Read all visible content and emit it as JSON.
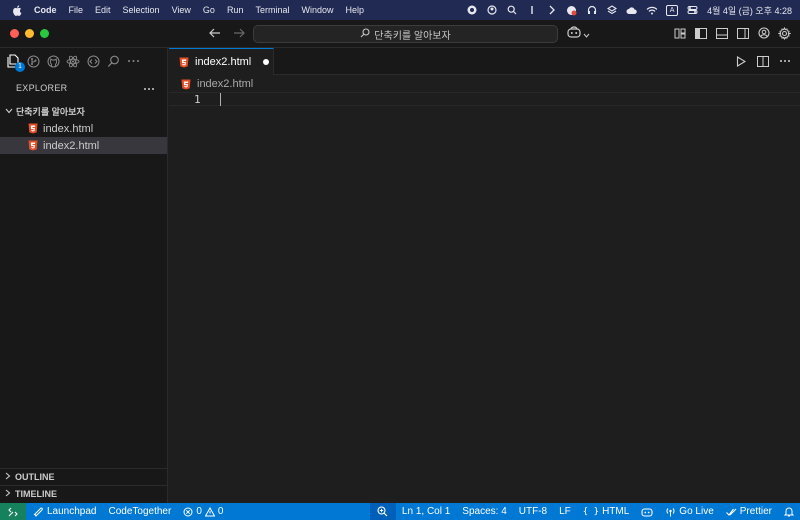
{
  "menubar": {
    "app": "Code",
    "items": [
      "File",
      "Edit",
      "Selection",
      "View",
      "Go",
      "Run",
      "Terminal",
      "Window",
      "Help"
    ],
    "input_indicator": "A",
    "clock": "4월 4일 (금) 오후 4:28"
  },
  "titlebar": {
    "command_center": "단축키를 알아보자"
  },
  "sidebar": {
    "explorer_title": "EXPLORER",
    "source_control_badge": "1",
    "folder_name": "단축키를 알아보자",
    "files": [
      {
        "name": "index.html",
        "selected": false
      },
      {
        "name": "index2.html",
        "selected": true
      }
    ],
    "outline_label": "OUTLINE",
    "timeline_label": "TIMELINE"
  },
  "editor": {
    "tab_label": "index2.html",
    "breadcrumb": "index2.html",
    "line_number": "1"
  },
  "statusbar": {
    "launchpad": "Launchpad",
    "codetogether": "CodeTogether",
    "errors": "0",
    "warnings": "0",
    "position": "Ln 1, Col 1",
    "spaces": "Spaces: 4",
    "encoding": "UTF-8",
    "eol": "LF",
    "language": "HTML",
    "golive": "Go Live",
    "prettier": "Prettier"
  },
  "colors": {
    "accent": "#0078d4",
    "html_icon": "#e44d26",
    "remote": "#16825d"
  }
}
